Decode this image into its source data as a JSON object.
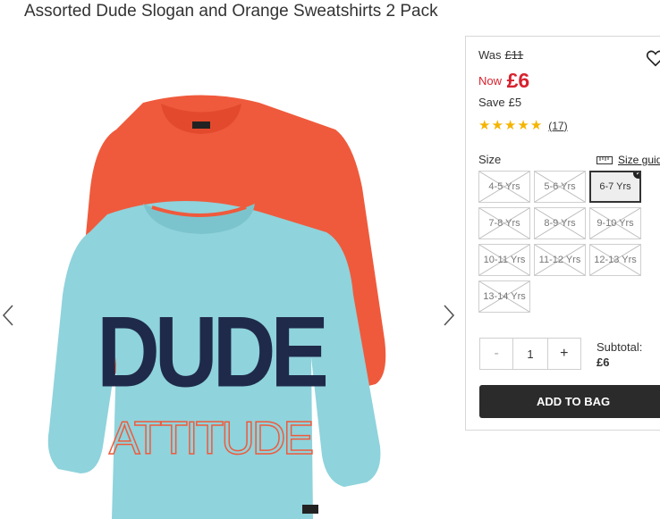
{
  "product": {
    "title": "Assorted Dude Slogan and Orange Sweatshirts 2 Pack",
    "image_slogan_line1": "DUDE",
    "image_slogan_line2": "ATTITUDE"
  },
  "price": {
    "was_label": "Was",
    "was_value": "£11",
    "now_label": "Now",
    "now_value": "£6",
    "save_label": "Save",
    "save_value": "£5"
  },
  "rating": {
    "stars": 5,
    "review_count": "(17)"
  },
  "size": {
    "label": "Size",
    "guide_label": "Size guide",
    "options": [
      {
        "label": "4-5 Yrs",
        "available": false,
        "selected": false
      },
      {
        "label": "5-6 Yrs",
        "available": false,
        "selected": false
      },
      {
        "label": "6-7 Yrs",
        "available": true,
        "selected": true
      },
      {
        "label": "7-8 Yrs",
        "available": false,
        "selected": false
      },
      {
        "label": "8-9 Yrs",
        "available": false,
        "selected": false
      },
      {
        "label": "9-10 Yrs",
        "available": false,
        "selected": false
      },
      {
        "label": "10-11 Yrs",
        "available": false,
        "selected": false
      },
      {
        "label": "11-12 Yrs",
        "available": false,
        "selected": false
      },
      {
        "label": "12-13 Yrs",
        "available": false,
        "selected": false
      },
      {
        "label": "13-14 Yrs",
        "available": false,
        "selected": false
      }
    ]
  },
  "quantity": {
    "minus": "-",
    "value": "1",
    "plus": "+"
  },
  "subtotal": {
    "label": "Subtotal:",
    "value": "£6"
  },
  "cart": {
    "add_label": "ADD TO BAG"
  },
  "colors": {
    "price_red": "#d7222f",
    "button_dark": "#2b2b2b",
    "star_gold": "#f5b400",
    "sweatshirt_orange": "#ef5a3c",
    "sweatshirt_blue": "#8fd3dc",
    "slogan_navy": "#1f2a4a"
  }
}
